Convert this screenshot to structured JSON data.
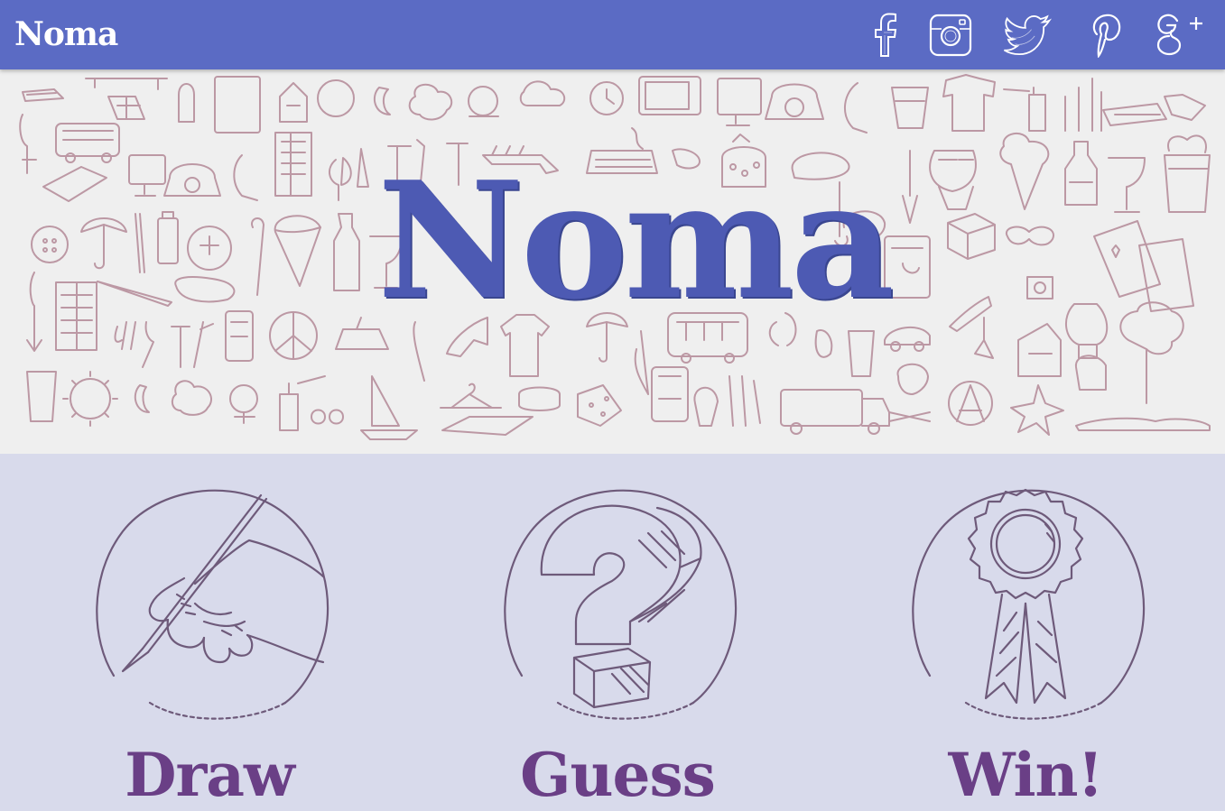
{
  "navbar": {
    "brand": "Noma",
    "background": "#5b6bc4",
    "social": [
      {
        "name": "facebook-icon"
      },
      {
        "name": "instagram-icon"
      },
      {
        "name": "twitter-icon"
      },
      {
        "name": "pinterest-icon"
      },
      {
        "name": "google-plus-icon"
      }
    ]
  },
  "hero": {
    "title": "Noma",
    "title_color": "#4d5ab3",
    "doodle_color": "#b48a98"
  },
  "steps": [
    {
      "label": "Draw",
      "icon": "drawing-hand-icon"
    },
    {
      "label": "Guess",
      "icon": "question-mark-icon"
    },
    {
      "label": "Win!",
      "icon": "award-ribbon-icon"
    }
  ],
  "colors": {
    "step_label": "#6a3f86",
    "step_line": "#6e5a7a",
    "steps_background": "#d8daeb"
  }
}
